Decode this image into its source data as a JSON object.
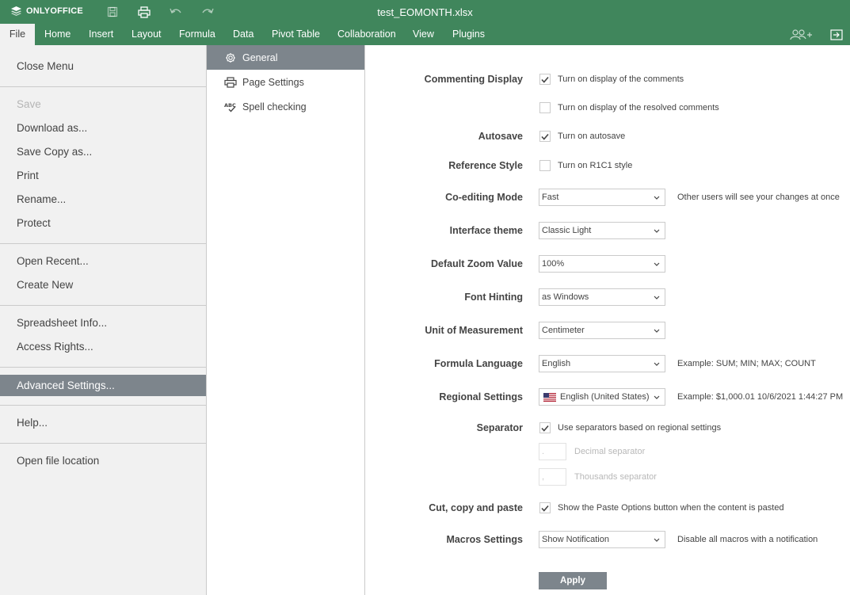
{
  "app": {
    "brand": "ONLYOFFICE",
    "doc_title": "test_EOMONTH.xlsx",
    "accent": "#40865c",
    "selected_bg": "#7d858c"
  },
  "toolbar_icons": [
    "save-icon",
    "print-icon",
    "undo-icon",
    "redo-icon"
  ],
  "tabs": [
    {
      "label": "File",
      "active": true
    },
    {
      "label": "Home"
    },
    {
      "label": "Insert"
    },
    {
      "label": "Layout"
    },
    {
      "label": "Formula"
    },
    {
      "label": "Data"
    },
    {
      "label": "Pivot Table"
    },
    {
      "label": "Collaboration"
    },
    {
      "label": "View"
    },
    {
      "label": "Plugins"
    }
  ],
  "file_menu": {
    "items": [
      {
        "label": "Close Menu"
      },
      {
        "label": "Save",
        "disabled": true
      },
      {
        "label": "Download as..."
      },
      {
        "label": "Save Copy as..."
      },
      {
        "label": "Print"
      },
      {
        "label": "Rename..."
      },
      {
        "label": "Protect"
      },
      {
        "label": "Open Recent..."
      },
      {
        "label": "Create New"
      },
      {
        "label": "Spreadsheet Info..."
      },
      {
        "label": "Access Rights..."
      },
      {
        "label": "Advanced Settings...",
        "selected": true
      },
      {
        "label": "Help..."
      },
      {
        "label": "Open file location"
      }
    ]
  },
  "settings_nav": [
    {
      "label": "General",
      "icon": "gear-icon",
      "selected": true
    },
    {
      "label": "Page Settings",
      "icon": "printer-icon"
    },
    {
      "label": "Spell checking",
      "icon": "spellcheck-icon"
    }
  ],
  "settings": {
    "commenting": {
      "label": "Commenting Display",
      "option1": "Turn on display of the comments",
      "option1_checked": true,
      "option2": "Turn on display of the resolved comments",
      "option2_checked": false
    },
    "autosave": {
      "label": "Autosave",
      "option": "Turn on autosave",
      "checked": true
    },
    "reference_style": {
      "label": "Reference Style",
      "option": "Turn on R1C1 style",
      "checked": false
    },
    "coediting": {
      "label": "Co-editing Mode",
      "value": "Fast",
      "note": "Other users will see your changes at once"
    },
    "theme": {
      "label": "Interface theme",
      "value": "Classic Light"
    },
    "zoom": {
      "label": "Default Zoom Value",
      "value": "100%"
    },
    "font_hinting": {
      "label": "Font Hinting",
      "value": "as Windows"
    },
    "unit": {
      "label": "Unit of Measurement",
      "value": "Centimeter"
    },
    "formula_language": {
      "label": "Formula Language",
      "value": "English",
      "note": "Example: SUM; MIN; MAX; COUNT"
    },
    "regional": {
      "label": "Regional Settings",
      "value": "English (United States)",
      "note": "Example: $1,000.01 10/6/2021 1:44:27 PM"
    },
    "separator": {
      "label": "Separator",
      "option": "Use separators based on regional settings",
      "checked": true,
      "decimal_value": ".",
      "decimal_label": "Decimal separator",
      "thousands_value": ",",
      "thousands_label": "Thousands separator"
    },
    "cut_copy": {
      "label": "Cut, copy and paste",
      "option": "Show the Paste Options button when the content is pasted",
      "checked": true
    },
    "macros": {
      "label": "Macros Settings",
      "value": "Show Notification",
      "note": "Disable all macros with a notification"
    },
    "apply_label": "Apply"
  }
}
